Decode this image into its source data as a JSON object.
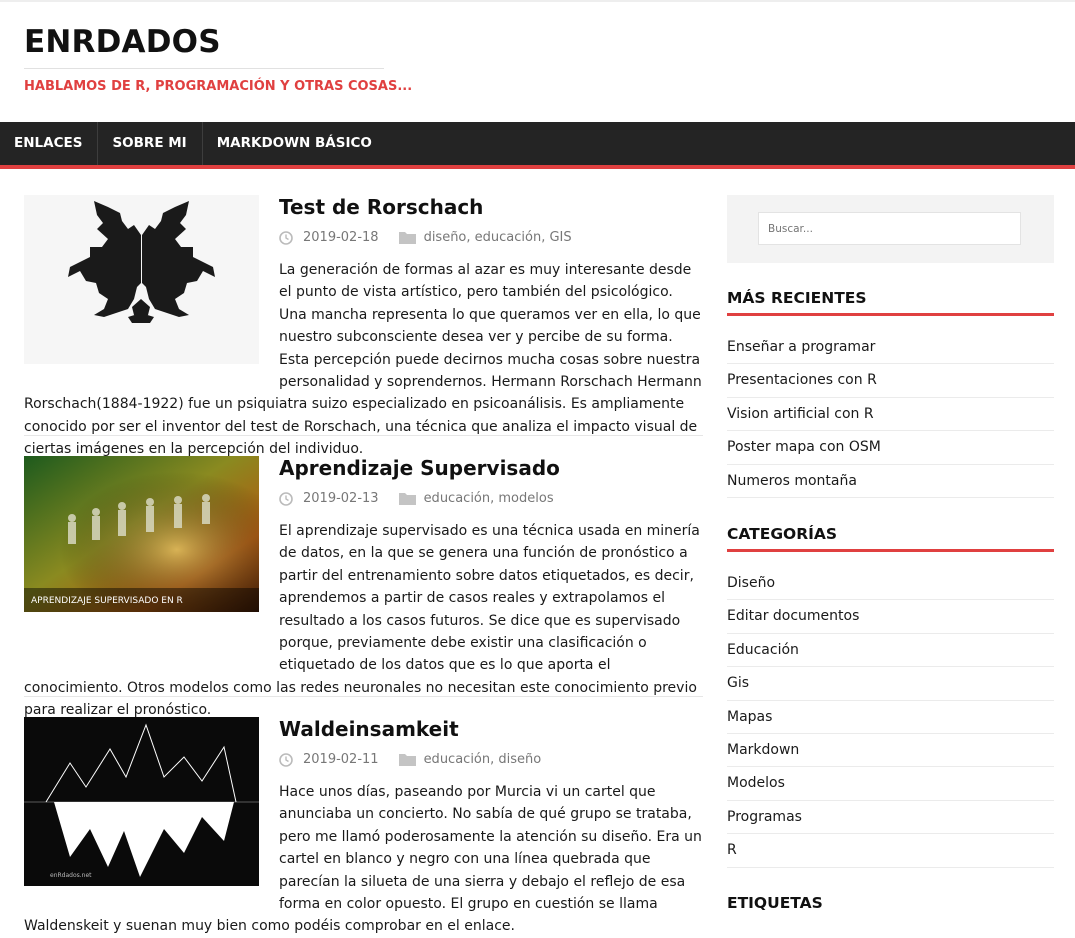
{
  "header": {
    "site_title": "ENRDADOS",
    "tagline": "HABLAMOS DE R, PROGRAMACIÓN Y OTRAS COSAS..."
  },
  "nav": {
    "items": [
      "ENLACES",
      "SOBRE MI",
      "MARKDOWN BÁSICO"
    ]
  },
  "posts": [
    {
      "title": "Test de Rorschach",
      "date": "2019-02-18",
      "categories": "diseño, educación, GIS",
      "excerpt": "La generación de formas al azar es muy interesante desde el punto de vista artístico, pero también del psicológico. Una mancha representa lo que queramos ver en ella, lo que nuestro subconsciente desea ver y percibe de su forma. Esta percepción puede decirnos mucha cosas sobre nuestra personalidad y soprendernos. Hermann Rorschach Hermann Rorschach(1884-1922) fue un psiquiatra suizo especializado en psicoanálisis. Es ampliamente conocido por ser el inventor del test de Rorschach, una técnica que analiza el impacto visual de ciertas imágenes en la percepción del individuo."
    },
    {
      "title": "Aprendizaje Supervisado",
      "date": "2019-02-13",
      "categories": "educación, modelos",
      "thumb_caption": "APRENDIZAJE SUPERVISADO EN R",
      "excerpt": "El aprendizaje supervisado es una técnica usada en minería de datos, en la que se genera una función de pronóstico a partir del entrenamiento sobre datos etiquetados, es decir, aprendemos a partir de casos reales y extrapolamos el resultado a los casos futuros. Se dice que es supervisado porque, previamente debe existir una clasificación o etiquetado de los datos que es lo que aporta el conocimiento. Otros modelos como las redes neuronales no necesitan este conocimiento previo para realizar el pronóstico."
    },
    {
      "title": "Waldeinsamkeit",
      "date": "2019-02-11",
      "categories": "educación, diseño",
      "thumb_caption": "enRdados.net",
      "excerpt": "Hace unos días, paseando por Murcia vi un cartel que anunciaba un concierto. No sabía de qué grupo se trataba, pero me llamó poderosamente la atención su diseño. Era un cartel en blanco y negro con una línea quebrada que parecían la silueta de una sierra y debajo el reflejo de esa forma en color opuesto. El grupo en cuestión se llama Waldenskeit y suenan muy bien como podéis comprobar en el enlace."
    }
  ],
  "sidebar": {
    "search_placeholder": "Buscar...",
    "recent_title": "MÁS RECIENTES",
    "recent": [
      "Enseñar a programar",
      "Presentaciones con R",
      "Vision artificial con R",
      "Poster mapa con OSM",
      "Numeros montaña"
    ],
    "categories_title": "CATEGORÍAS",
    "categories": [
      "Diseño",
      "Editar documentos",
      "Educación",
      "Gis",
      "Mapas",
      "Markdown",
      "Modelos",
      "Programas",
      "R"
    ],
    "tags_title": "ETIQUETAS"
  },
  "colors": {
    "accent": "#e04040",
    "nav_bg": "#242424",
    "widget_bg": "#f3f3f3"
  },
  "icons": {
    "date": "clock-icon",
    "categories": "folder-icon"
  }
}
